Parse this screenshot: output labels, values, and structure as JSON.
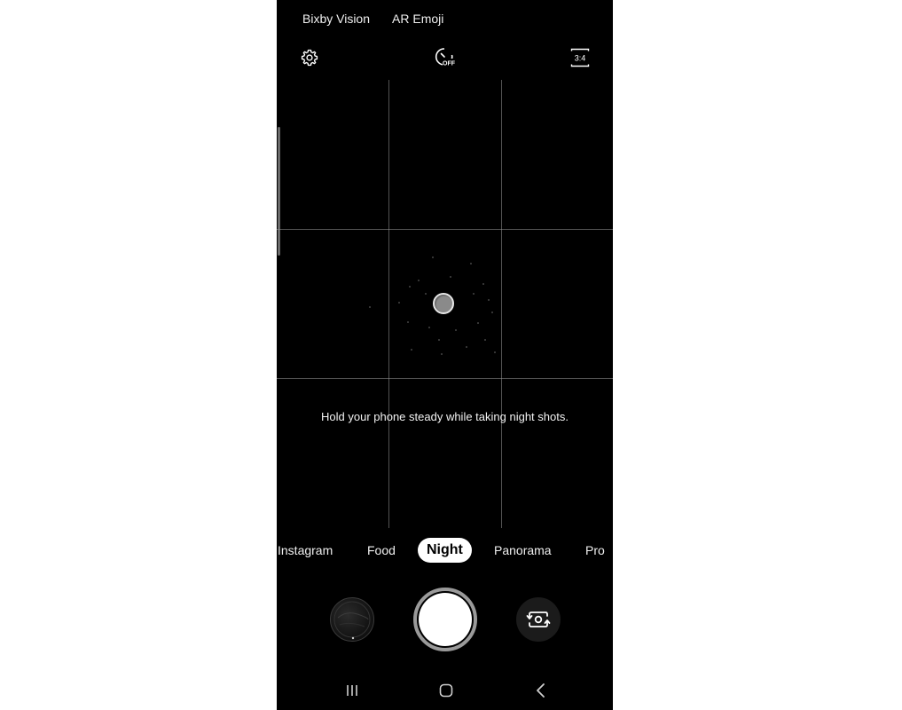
{
  "top_links": {
    "bixby_vision": "Bixby Vision",
    "ar_emoji": "AR Emoji"
  },
  "toolbar": {
    "settings_icon": "gear-icon",
    "timer_icon": "timer-off-icon",
    "timer_label": "OFF",
    "ratio_icon": "aspect-ratio-icon",
    "ratio_label": "3:4"
  },
  "viewfinder": {
    "hint": "Hold your phone steady while taking night shots."
  },
  "modes": {
    "items": [
      "Instagram",
      "Food",
      "Night",
      "Panorama",
      "Pro"
    ],
    "selected": "Night"
  },
  "controls": {
    "gallery_thumbnail": "gallery-thumbnail",
    "shutter": "shutter-button",
    "switch_camera_icon": "switch-camera-icon"
  },
  "navbar": {
    "recents_icon": "recents-icon",
    "home_icon": "home-icon",
    "back_icon": "back-icon"
  },
  "colors": {
    "background": "#000000",
    "text": "#ffffff",
    "selected_mode_bg": "#ffffff",
    "selected_mode_text": "#000000",
    "shutter_ring": "#9a9a9a"
  }
}
